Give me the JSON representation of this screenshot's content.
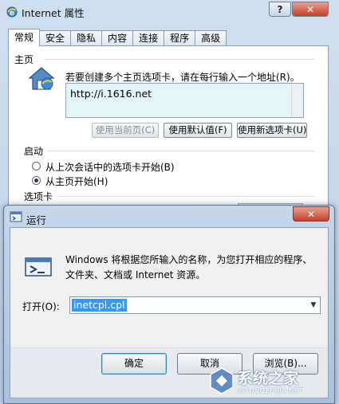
{
  "internet_options": {
    "title": "Internet 属性",
    "help_glyph": "?",
    "close_glyph": "✕",
    "tabs": [
      "常规",
      "安全",
      "隐私",
      "内容",
      "连接",
      "程序",
      "高级"
    ],
    "active_tab": "常规",
    "home_section": {
      "label": "主页",
      "description": "若要创建多个主页选项卡，请在每行输入一个地址(R)。",
      "url": "http://i.1616.net",
      "buttons": {
        "use_current": "使用当前页(C)",
        "use_default": "使用默认值(F)",
        "use_new_tab": "使用新选项卡(U)"
      }
    },
    "startup_section": {
      "label": "启动",
      "options": [
        {
          "label": "从上次会话中的选项卡开始(B)",
          "checked": false
        },
        {
          "label": "从主页开始(H)",
          "checked": true
        }
      ]
    },
    "tabs_section": {
      "label": "选项卡"
    }
  },
  "run_dialog": {
    "title": "运行",
    "close_glyph": "✕",
    "description_line1": "Windows 将根据您所输入的名称，为您打开相应的程序、",
    "description_line2": "文件夹、文档或 Internet 资源。",
    "open_label": "打开(O):",
    "open_value": "inetcpl.cpl",
    "combo_arrow": "▼",
    "buttons": {
      "ok": "确定",
      "cancel": "取消",
      "browse": "浏览(B)..."
    }
  },
  "watermark": {
    "text": "系统之家",
    "url": "XITONGZHIJIA.NET"
  }
}
